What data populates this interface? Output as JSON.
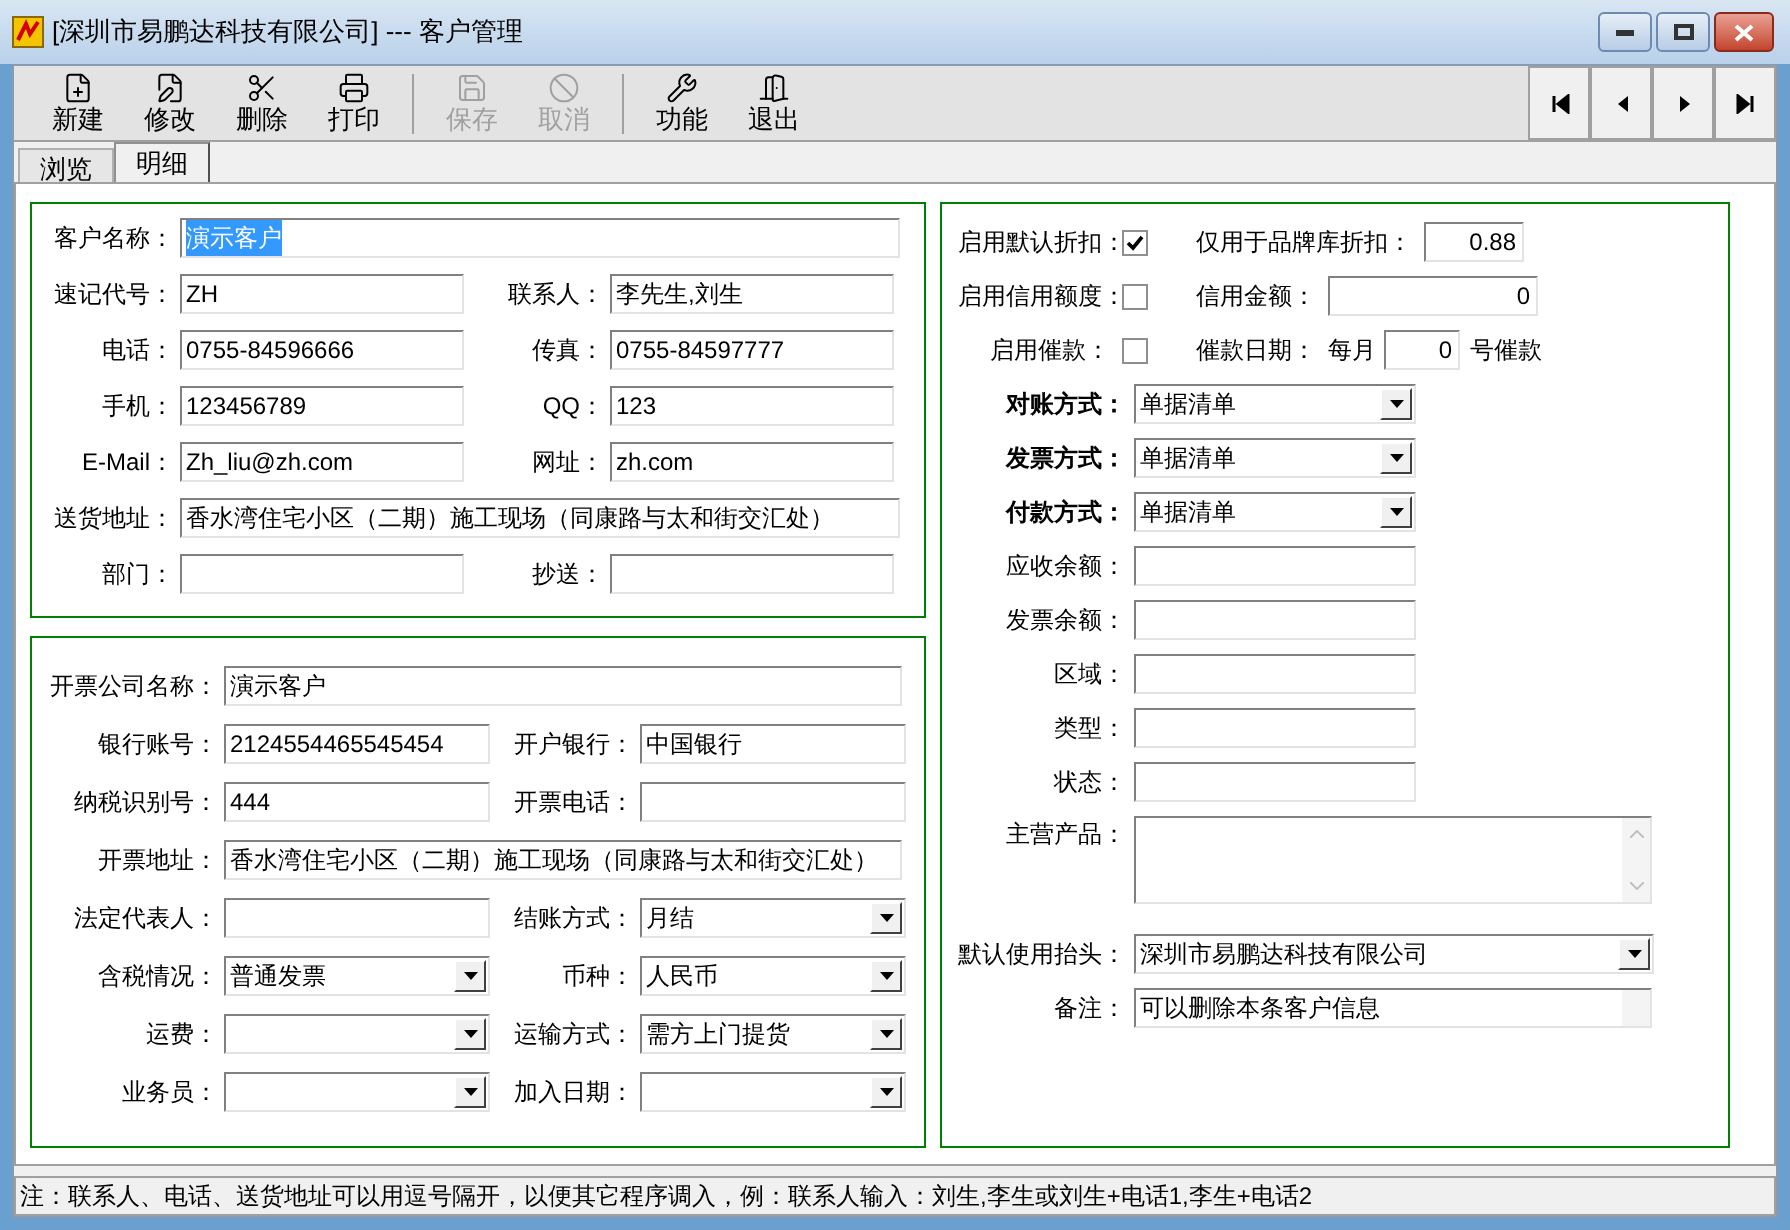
{
  "window": {
    "title": "[深圳市易鹏达科技有限公司] --- 客户管理"
  },
  "toolbar": {
    "buttons": [
      {
        "label": "新建",
        "disabled": false
      },
      {
        "label": "修改",
        "disabled": false
      },
      {
        "label": "删除",
        "disabled": false
      },
      {
        "label": "打印",
        "disabled": false
      },
      {
        "label": "保存",
        "disabled": true
      },
      {
        "label": "取消",
        "disabled": true
      },
      {
        "label": "功能",
        "disabled": false
      },
      {
        "label": "退出",
        "disabled": false
      }
    ]
  },
  "tabs": [
    {
      "label": "浏览",
      "selected": false
    },
    {
      "label": "明细",
      "selected": true
    }
  ],
  "contact_group": {
    "rows": [
      [
        {
          "label": "客户名称：",
          "value": "演示客户",
          "kind": "text",
          "highlighted": true
        }
      ],
      [
        {
          "label": "速记代号：",
          "value": "ZH",
          "kind": "text",
          "highlighted": false
        },
        {
          "label": "联系人：",
          "value": "李先生,刘生",
          "kind": "text",
          "highlighted": false
        }
      ],
      [
        {
          "label": "电话：",
          "value": "0755-84596666",
          "kind": "text",
          "highlighted": false
        },
        {
          "label": "传真：",
          "value": "0755-84597777",
          "kind": "text",
          "highlighted": false
        }
      ],
      [
        {
          "label": "手机：",
          "value": "123456789",
          "kind": "text",
          "highlighted": false
        },
        {
          "label": "QQ：",
          "value": "123",
          "kind": "text",
          "highlighted": false
        }
      ],
      [
        {
          "label": "E-Mail：",
          "value": "Zh_liu@zh.com",
          "kind": "text",
          "highlighted": false
        },
        {
          "label": "网址：",
          "value": "zh.com",
          "kind": "text",
          "highlighted": false
        }
      ],
      [
        {
          "label": "送货地址：",
          "value": "香水湾住宅小区（二期）施工现场（同康路与太和街交汇处）",
          "kind": "text",
          "highlighted": false
        }
      ],
      [
        {
          "label": "部门：",
          "kind": "text",
          "highlighted": false
        },
        {
          "label": "抄送：",
          "kind": "text",
          "highlighted": false
        }
      ]
    ]
  },
  "invoice_group": {
    "rows": [
      [
        {
          "label": "开票公司名称：",
          "value": "演示客户",
          "kind": "text"
        }
      ],
      [
        {
          "label": "银行账号：",
          "value": "2124554465545454",
          "kind": "text"
        },
        {
          "label": "开户银行：",
          "value": "中国银行",
          "kind": "text"
        }
      ],
      [
        {
          "label": "纳税识别号：",
          "value": "444",
          "kind": "text"
        },
        {
          "label": "开票电话：",
          "kind": "text"
        }
      ],
      [
        {
          "label": "开票地址：",
          "value": "香水湾住宅小区（二期）施工现场（同康路与太和街交汇处）",
          "kind": "text"
        }
      ],
      [
        {
          "label": "法定代表人：",
          "kind": "text"
        },
        {
          "label": "结账方式：",
          "value": "月结",
          "kind": "combo"
        }
      ],
      [
        {
          "label": "含税情况：",
          "value": "普通发票",
          "kind": "combo"
        },
        {
          "label": "币种：",
          "value": "人民币",
          "kind": "combo"
        }
      ],
      [
        {
          "label": "运费：",
          "kind": "combo"
        },
        {
          "label": "运输方式：",
          "value": "需方上门提货",
          "kind": "combo"
        }
      ],
      [
        {
          "label": "业务员：",
          "kind": "combo"
        },
        {
          "label": "加入日期：",
          "kind": "combo"
        }
      ]
    ]
  },
  "settings_group": {
    "options": [
      {
        "label": "启用默认折扣：",
        "checked": true,
        "field_label": "仅用于品牌库折扣：",
        "value": "0.88"
      },
      {
        "label": "启用信用额度：",
        "checked": false,
        "field_label": "信用金额：",
        "value": "0"
      },
      {
        "label": "启用催款：",
        "checked": false,
        "field_label": "催款日期：",
        "prefix": "每月",
        "value": "0",
        "suffix": "号催款"
      }
    ],
    "fields": [
      {
        "label": "对账方式：",
        "value": "单据清单",
        "kind": "combo",
        "bold": true
      },
      {
        "label": "发票方式：",
        "value": "单据清单",
        "kind": "combo",
        "bold": true
      },
      {
        "label": "付款方式：",
        "value": "单据清单",
        "kind": "combo",
        "bold": true
      },
      {
        "label": "应收余额：",
        "kind": "text",
        "bold": false
      },
      {
        "label": "发票余额：",
        "kind": "text",
        "bold": false
      },
      {
        "label": "区域：",
        "kind": "text",
        "bold": false
      },
      {
        "label": "类型：",
        "kind": "text",
        "bold": false
      },
      {
        "label": "状态：",
        "kind": "text",
        "bold": false
      },
      {
        "label": "主营产品：",
        "kind": "memo",
        "bold": false
      },
      {
        "label": "默认使用抬头：",
        "value": "深圳市易鹏达科技有限公司",
        "kind": "combo_wide",
        "bold": false
      },
      {
        "label": "备注：",
        "value": "可以删除本条客户信息",
        "kind": "note",
        "bold": false
      }
    ]
  },
  "status_bar": {
    "text": "注：联系人、电话、送货地址可以用逗号隔开，以便其它程序调入，例：联系人输入：刘生,李生或刘生+电话1,李生+电话2"
  }
}
